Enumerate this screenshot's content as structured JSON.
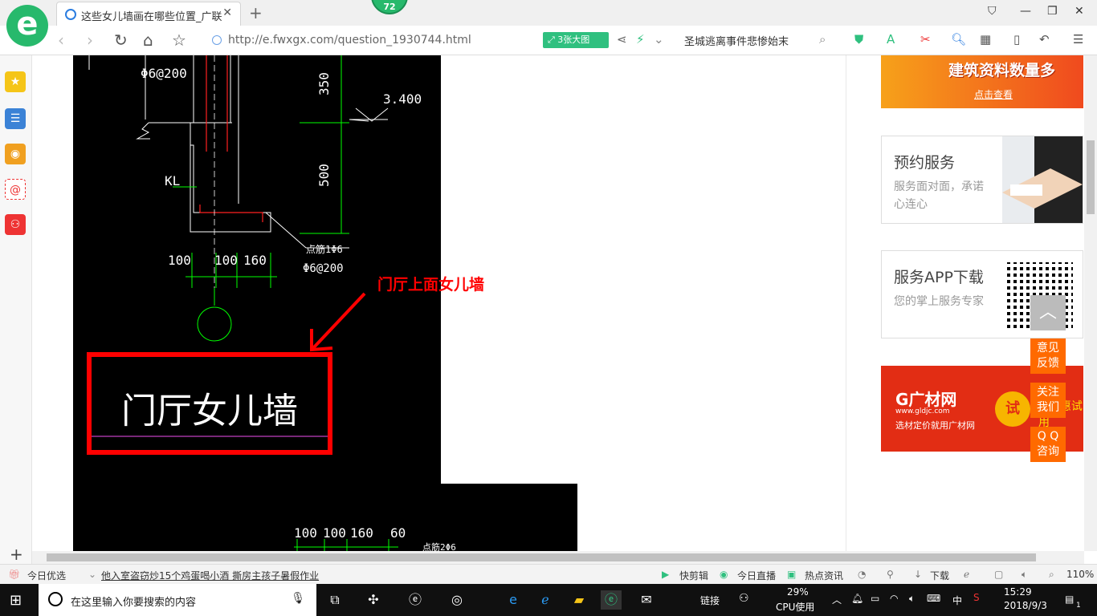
{
  "browser": {
    "tab_title": "这些女儿墙画在哪些位置_广联达",
    "tab_close": "✕",
    "new_tab": "+",
    "badge_count": "72",
    "url": "http://e.fwxgx.com/question_1930744.html",
    "bigpic_label": "3张大图",
    "search_text": "圣城逃离事件悲惨始末"
  },
  "cad": {
    "dim_350": "350",
    "dim_500": "500",
    "elev": "3.400",
    "rebar_top": "Φ6@200",
    "kl": "KL",
    "note1": "点筋1Φ6",
    "note2": "Φ6@200",
    "dims_row1": [
      "100",
      "100",
      "160"
    ],
    "dims_row2": [
      "100",
      "100",
      "160",
      "60"
    ],
    "note3": "点筋2Φ6",
    "label": "门厅女儿墙"
  },
  "annotation": "门厅上面女儿墙",
  "ads": {
    "top_title": "建筑资料数量多",
    "top_sub": "点击查看",
    "card1_title": "预约服务",
    "card1_desc": "服务面对面，承诺心连心",
    "card2_title": "服务APP下载",
    "card2_desc": "您的掌上服务专家",
    "gc_logo": "G广材网",
    "gc_url": "www.gldjc.com",
    "gc_sub": "选材定价就用广材网",
    "gc_try": "试",
    "gc_side": "P 优惠试用"
  },
  "float": {
    "feedback": [
      "意见",
      "反馈"
    ],
    "follow": [
      "关注",
      "我们"
    ],
    "qq": [
      "Q Q",
      "咨询"
    ]
  },
  "statusbar": {
    "today": "今日优选",
    "news": "他入室盗窃炒15个鸡蛋喝小酒 撕房主孩子暑假作业",
    "quickclip": "快剪辑",
    "live": "今日直播",
    "hot": "热点资讯",
    "download": "下载",
    "zoom": "110%"
  },
  "taskbar": {
    "search_placeholder": "在这里输入你要搜索的内容",
    "links": "链接",
    "cpu_percent": "29%",
    "cpu_label": "CPU使用",
    "ime": "中",
    "time": "15:29",
    "date": "2018/9/3",
    "notif": "1"
  }
}
